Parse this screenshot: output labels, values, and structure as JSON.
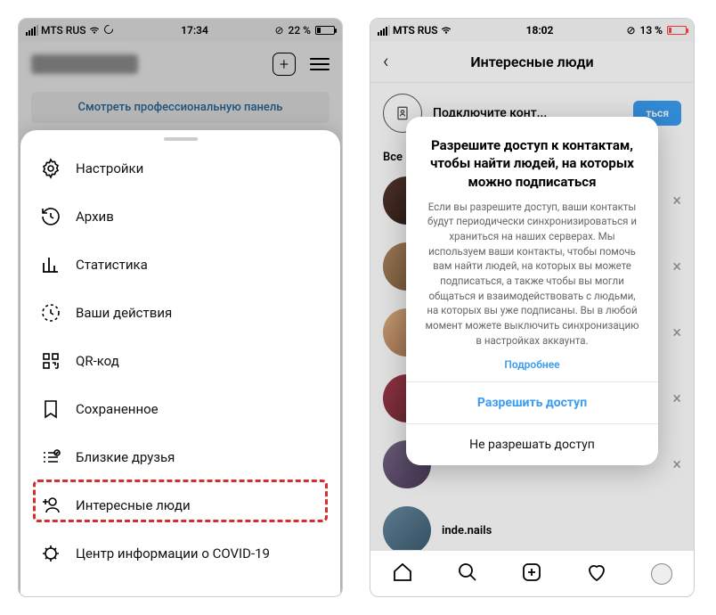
{
  "left": {
    "status": {
      "carrier": "MTS RUS",
      "time": "17:34",
      "battery": "22 %"
    },
    "banner": "Смотреть профессиональную панель",
    "menu": {
      "settings": "Настройки",
      "archive": "Архив",
      "insights": "Статистика",
      "activity": "Ваши действия",
      "qr": "QR-код",
      "saved": "Сохраненное",
      "closefriends": "Близкие друзья",
      "discover": "Интересные люди",
      "covid": "Центр информации о COVID-19"
    }
  },
  "right": {
    "status": {
      "carrier": "MTS RUS",
      "time": "18:02",
      "battery": "13 %"
    },
    "title": "Интересные люди",
    "contact_prompt": "Подключите конт...",
    "subscribe_btn": "ться",
    "section": "Все р",
    "modal": {
      "title": "Разрешите доступ к контактам, чтобы найти людей, на которых можно подписаться",
      "body": "Если вы разрешите доступ, ваши контакты будут периодически синхронизироваться и храниться на наших серверах. Мы используем ваши контакты, чтобы помочь вам найти людей, на которых вы можете подписаться, а также чтобы вы могли общаться и взаимодействовать с людьми, на которых вы уже подписаны. Вы в любой момент можете выключить синхронизацию в настройках аккаунта.",
      "more": "Подробнее",
      "allow": "Разрешить доступ",
      "deny": "Не разрешать доступ"
    },
    "visible_user": "inde.nails"
  }
}
